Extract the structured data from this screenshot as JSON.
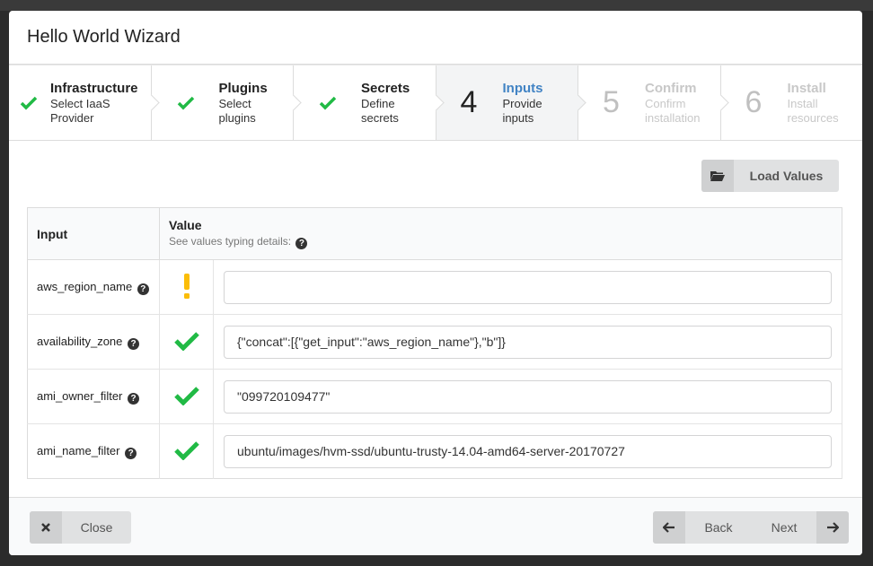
{
  "modal": {
    "title": "Hello World Wizard"
  },
  "steps": [
    {
      "title": "Infrastructure",
      "desc1": "Select IaaS",
      "desc2": "Provider",
      "state": "done"
    },
    {
      "title": "Plugins",
      "desc1": "Select",
      "desc2": "plugins",
      "state": "done"
    },
    {
      "title": "Secrets",
      "desc1": "Define",
      "desc2": "secrets",
      "state": "done"
    },
    {
      "num": "4",
      "title": "Inputs",
      "desc1": "Provide",
      "desc2": "inputs",
      "state": "active"
    },
    {
      "num": "5",
      "title": "Confirm",
      "desc1": "Confirm",
      "desc2": "installation",
      "state": "disabled"
    },
    {
      "num": "6",
      "title": "Install",
      "desc1": "Install",
      "desc2": "resources",
      "state": "disabled"
    }
  ],
  "toolbar": {
    "load_label": "Load Values",
    "load_icon": "folder-open-icon"
  },
  "table": {
    "col_input": "Input",
    "col_value": "Value",
    "col_value_sub": "See values typing details:",
    "rows": [
      {
        "name": "aws_region_name",
        "status": "warning",
        "value": ""
      },
      {
        "name": "availability_zone",
        "status": "ok",
        "value": "{\"concat\":[{\"get_input\":\"aws_region_name\"},\"b\"]}"
      },
      {
        "name": "ami_owner_filter",
        "status": "ok",
        "value": "\"099720109477\""
      },
      {
        "name": "ami_name_filter",
        "status": "ok",
        "value": "ubuntu/images/hvm-ssd/ubuntu-trusty-14.04-amd64-server-20170727"
      }
    ]
  },
  "footer": {
    "close_label": "Close",
    "back_label": "Back",
    "next_label": "Next"
  },
  "colors": {
    "accent": "#4183c4",
    "ok": "#21ba45",
    "warning": "#fbbd08"
  }
}
